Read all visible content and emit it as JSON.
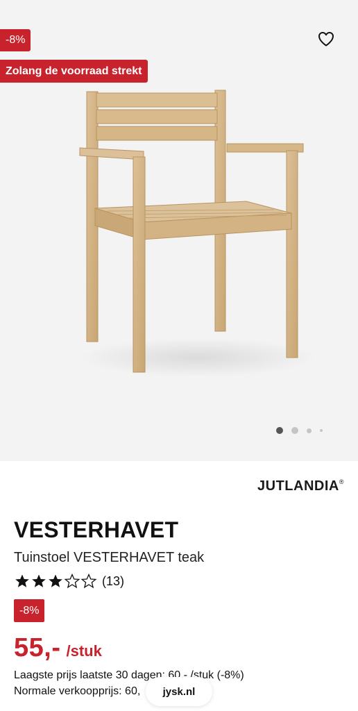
{
  "gallery": {
    "discount_badge": "-8%",
    "stock_badge": "Zolang de voorraad strekt",
    "wishlist_icon": "heart-outline-icon",
    "image_count": 4,
    "active_image_index": 0
  },
  "brand": {
    "name": "JUTLANDIA",
    "mark": "®"
  },
  "product": {
    "name": "VESTERHAVET",
    "subtitle": "Tuinstoel VESTERHAVET teak",
    "rating": {
      "stars_filled": 3,
      "stars_total": 5,
      "count": "(13)"
    },
    "discount_badge": "-8%",
    "price": {
      "value": "55,-",
      "unit": "/stuk"
    },
    "lowest_price": "Laagste prijs laatste 30 dagen: 60,- /stuk (-8%)",
    "normal_price": "Normale verkoopprijs: 60,"
  },
  "browser": {
    "url": "jysk.nl"
  },
  "colors": {
    "accent_red": "#c8232c",
    "gallery_bg": "#f3f3f3",
    "wood": "#d4b483"
  }
}
